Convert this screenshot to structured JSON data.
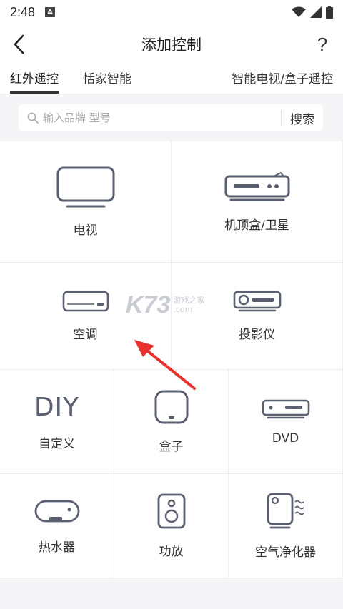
{
  "status": {
    "time": "2:48",
    "notif_icon": "A"
  },
  "header": {
    "title": "添加控制",
    "help": "?"
  },
  "tabs": [
    {
      "label": "红外遥控"
    },
    {
      "label": "恬家智能"
    },
    {
      "label": "智能电视/盒子遥控"
    }
  ],
  "search": {
    "placeholder": "输入品牌 型号",
    "button": "搜索"
  },
  "devices": {
    "tv": "电视",
    "stb": "机顶盒/卫星",
    "ac": "空调",
    "projector": "投影仪",
    "diy_icon_text": "DIY",
    "diy": "自定义",
    "box": "盒子",
    "dvd": "DVD",
    "water_heater": "热水器",
    "amplifier": "功放",
    "air_purifier": "空气净化器"
  },
  "watermark": {
    "logo": "K73",
    "site": "游戏之家",
    "domain": ".com"
  },
  "colors": {
    "icon": "#5a6070",
    "arrow": "#e8302c",
    "tab_indicator": "#333333"
  }
}
